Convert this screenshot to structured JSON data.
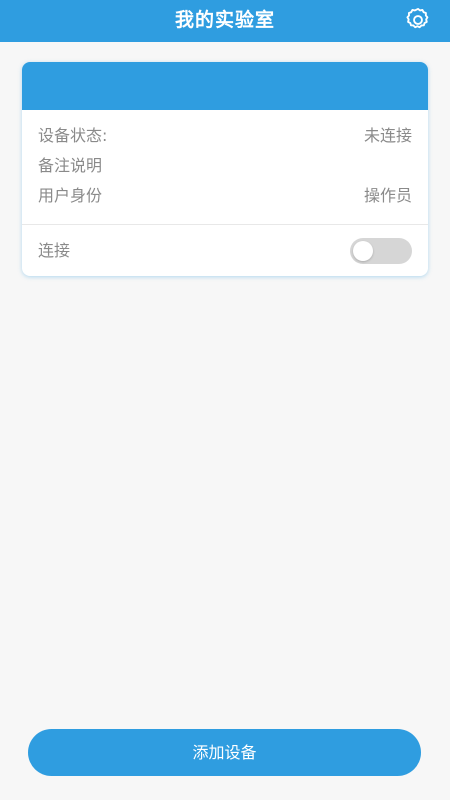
{
  "header": {
    "title": "我的实验室",
    "settings_icon": "gear-icon"
  },
  "device_card": {
    "title": "",
    "rows": [
      {
        "label": "设备状态:",
        "value": "未连接"
      },
      {
        "label": "备注说明",
        "value": ""
      },
      {
        "label": "用户身份",
        "value": "操作员"
      }
    ],
    "connect": {
      "label": "连接",
      "enabled": false
    }
  },
  "footer": {
    "add_label": "添加设备"
  },
  "colors": {
    "primary": "#2f9de0",
    "background": "#f7f7f7",
    "text_muted": "#8a8a8a",
    "toggle_off": "#d6d6d6"
  }
}
